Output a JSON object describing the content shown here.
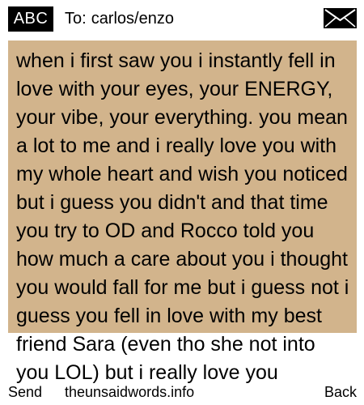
{
  "header": {
    "mode_label": "ABC",
    "to_label": "To:",
    "recipient": "carlos/enzo",
    "envelope_icon": "envelope-icon"
  },
  "message": {
    "body": "when i first saw you i instantly fell in love with your eyes, your ENERGY, your vibe, your everything. you mean a lot to me and i really love you with my whole heart and wish you noticed but i guess you didn't and that time you try to OD and Rocco told you how much a care about you i thought you would fall for me but i guess not i guess you fell in love with my best friend Sara (even tho she not into you LOL) but i really love you"
  },
  "colors": {
    "message_background": "#d2b48c",
    "badge_background": "#000000"
  },
  "softkeys": {
    "left": "Send",
    "center": "theunsaidwords.info",
    "right": "Back"
  }
}
